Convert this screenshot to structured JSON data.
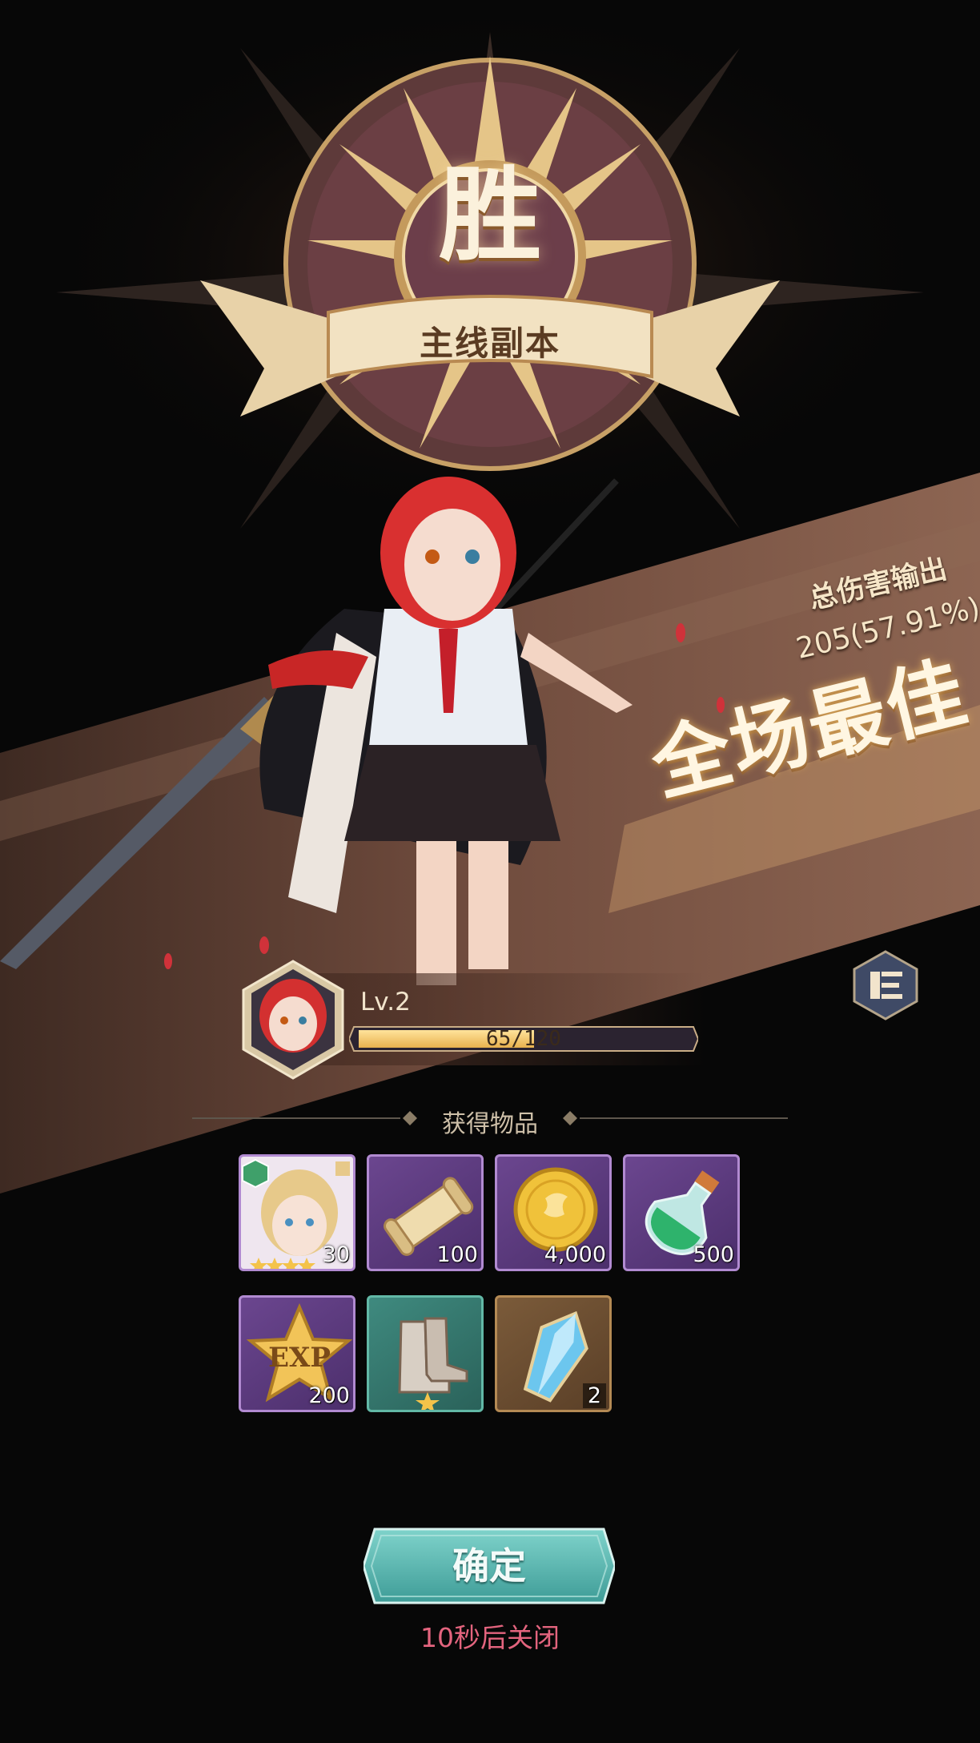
{
  "result": {
    "victory_char": "胜",
    "stage_name": "主线副本"
  },
  "mvp": {
    "damage_label": "总伤害输出",
    "damage_value": "205(57.91%)",
    "title": "全场最佳"
  },
  "hero": {
    "level": "Lv.2",
    "xp_text": "65/120",
    "xp_current": 65,
    "xp_max": 120
  },
  "rewards": {
    "title": "获得物品",
    "items": [
      {
        "icon": "hero-shard-icon",
        "quantity": "30",
        "stars": 4
      },
      {
        "icon": "scroll-icon",
        "quantity": "100"
      },
      {
        "icon": "gold-coin-icon",
        "quantity": "4,000"
      },
      {
        "icon": "potion-icon",
        "quantity": "500"
      },
      {
        "icon": "exp-star-icon",
        "quantity": "200"
      },
      {
        "icon": "boots-icon",
        "quantity": ""
      },
      {
        "icon": "crystal-icon",
        "quantity": "2"
      }
    ]
  },
  "confirm_label": "确定",
  "auto_close_text": "10秒后关闭",
  "colors": {
    "accent_gold": "#e9c884",
    "confirm_teal": "#4fb4ad",
    "close_text": "#e3647e"
  }
}
